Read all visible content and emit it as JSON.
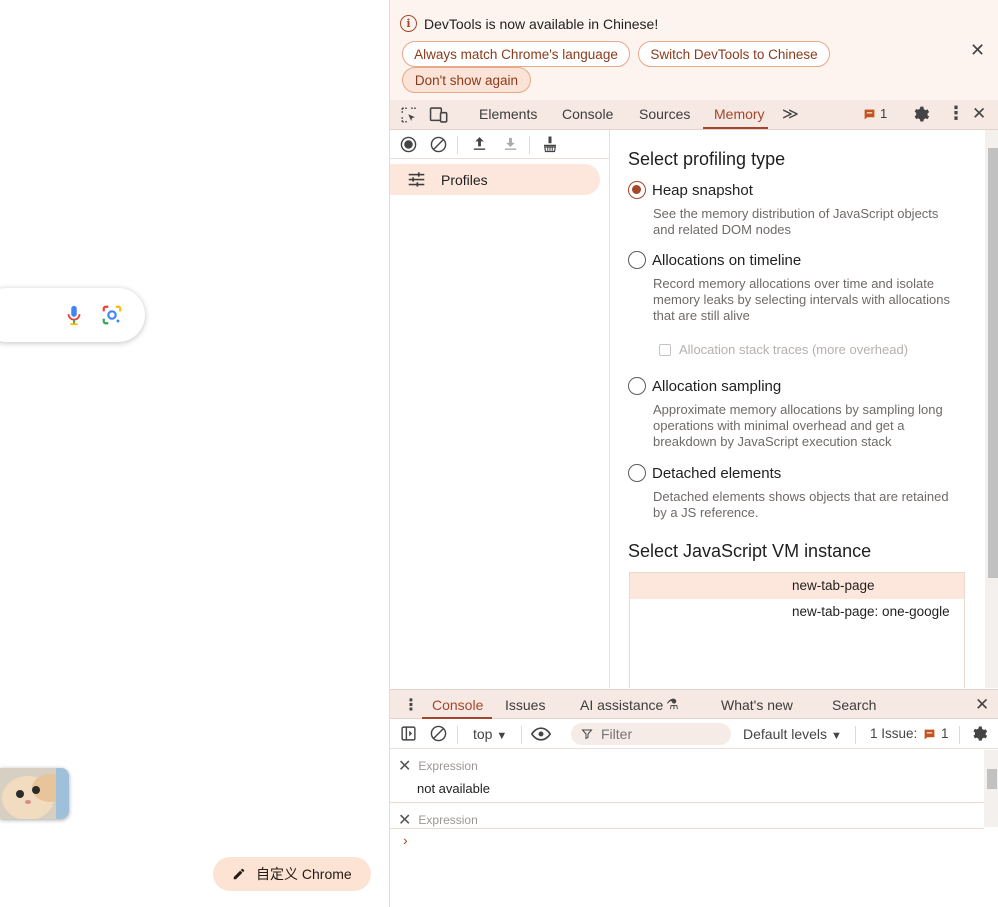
{
  "newtab": {
    "customize_label": "自定义 Chrome"
  },
  "infobar": {
    "message": "DevTools is now available in Chinese!",
    "btn_match": "Always match Chrome's language",
    "btn_switch": "Switch DevTools to Chinese",
    "btn_dont_show": "Don't show again"
  },
  "tabs": {
    "elements": "Elements",
    "console": "Console",
    "sources": "Sources",
    "memory": "Memory",
    "issues_count": "1"
  },
  "sidebar": {
    "profiles_label": "Profiles"
  },
  "memory": {
    "select_type_title": "Select profiling type",
    "options": [
      {
        "label": "Heap snapshot",
        "desc": "See the memory distribution of JavaScript objects and related DOM nodes",
        "selected": true
      },
      {
        "label": "Allocations on timeline",
        "desc": "Record memory allocations over time and isolate memory leaks by selecting intervals with allocations that are still alive",
        "selected": false
      },
      {
        "label": "Allocation sampling",
        "desc": "Approximate memory allocations by sampling long operations with minimal overhead and get a breakdown by JavaScript execution stack",
        "selected": false
      },
      {
        "label": "Detached elements",
        "desc": "Detached elements shows objects that are retained by a JS reference.",
        "selected": false
      }
    ],
    "stack_traces_label": "Allocation stack traces (more overhead)",
    "vm_title": "Select JavaScript VM instance",
    "vm_instances": [
      "new-tab-page",
      "new-tab-page: one-google"
    ]
  },
  "drawer": {
    "tab_console": "Console",
    "tab_issues": "Issues",
    "tab_ai": "AI assistance",
    "tab_whats_new": "What's new",
    "tab_search": "Search"
  },
  "console_toolbar": {
    "context": "top",
    "filter_placeholder": "Filter",
    "levels": "Default levels",
    "issues_label": "1 Issue:",
    "issues_count": "1"
  },
  "console": {
    "expression_placeholder": "Expression",
    "expression_value": "not available",
    "expression2_placeholder": "Expression"
  },
  "colors": {
    "accent": "#a5462a",
    "selection_bg": "#fde7dc",
    "tabbar_bg": "#f6e9e3"
  }
}
